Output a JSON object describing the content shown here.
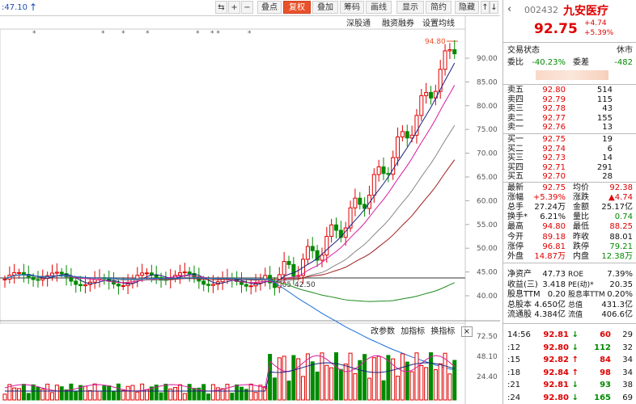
{
  "top_left_text": ":47.10",
  "toolbar": {
    "buttons": [
      "⇆",
      "+",
      "−",
      "叠点",
      "复权",
      "叠加",
      "筹码",
      "画线",
      "显示",
      "简约",
      "隐藏"
    ],
    "active": "复权",
    "scroll_up": "↑",
    "scroll_down": "↓"
  },
  "subbar": {
    "a": "深股通",
    "b": "融资融券",
    "c": "设置均线"
  },
  "star_markers": [
    "*",
    "*",
    "*",
    "*",
    "*",
    "* *",
    "*"
  ],
  "main_chart": {
    "high_label": "94.80",
    "low_label": "42.50",
    "low_date_label": "2.05",
    "price_axis": [
      "90.00",
      "85.00",
      "80.00",
      "75.00",
      "70.00",
      "65.00",
      "60.00",
      "55.00",
      "50.00",
      "45.00",
      "40.00"
    ]
  },
  "vol_chart": {
    "buttons": [
      "改参数",
      "加指标",
      "换指标"
    ],
    "close": "×",
    "axis": [
      "72.50",
      "48.10",
      "24.40"
    ]
  },
  "stock": {
    "code": "002432",
    "name": "九安医疗",
    "price": "92.75",
    "change": "+4.74",
    "pct": "+5.39%"
  },
  "status": {
    "label": "交易状态",
    "value": "休市"
  },
  "ratio": {
    "wb_label": "委比",
    "wb": "-40.23%",
    "wc_label": "委差",
    "wc": "-482"
  },
  "asks": [
    {
      "label": "卖五",
      "price": "92.80",
      "vol": "514"
    },
    {
      "label": "卖四",
      "price": "92.79",
      "vol": "115"
    },
    {
      "label": "卖三",
      "price": "92.78",
      "vol": "43"
    },
    {
      "label": "卖二",
      "price": "92.77",
      "vol": "155"
    },
    {
      "label": "卖一",
      "price": "92.76",
      "vol": "13"
    }
  ],
  "bids": [
    {
      "label": "买一",
      "price": "92.75",
      "vol": "19"
    },
    {
      "label": "买二",
      "price": "92.74",
      "vol": "6"
    },
    {
      "label": "买三",
      "price": "92.73",
      "vol": "14"
    },
    {
      "label": "买四",
      "price": "92.71",
      "vol": "291"
    },
    {
      "label": "买五",
      "price": "92.70",
      "vol": "28"
    }
  ],
  "stats": [
    {
      "l1": "最新",
      "v1": "92.75",
      "c1": "red",
      "l2": "均价",
      "v2": "92.38",
      "c2": "red"
    },
    {
      "l1": "涨幅",
      "v1": "+5.39%",
      "c1": "red",
      "l2": "涨跌",
      "v2": "▲4.74",
      "c2": "red"
    },
    {
      "l1": "总手",
      "v1": "27.24万",
      "c1": "black",
      "l2": "金额",
      "v2": "25.17亿",
      "c2": "black"
    },
    {
      "l1": "换手*",
      "v1": "6.21%",
      "c1": "black",
      "l2": "量比",
      "v2": "0.74",
      "c2": "green"
    },
    {
      "l1": "最高",
      "v1": "94.80",
      "c1": "red",
      "l2": "最低",
      "v2": "88.25",
      "c2": "red"
    },
    {
      "l1": "今开",
      "v1": "89.18",
      "c1": "red",
      "l2": "昨收",
      "v2": "88.01",
      "c2": "black"
    },
    {
      "l1": "涨停",
      "v1": "96.81",
      "c1": "red",
      "l2": "跌停",
      "v2": "79.21",
      "c2": "green"
    },
    {
      "l1": "外盘",
      "v1": "14.87万",
      "c1": "red",
      "l2": "内盘",
      "v2": "12.38万",
      "c2": "green"
    }
  ],
  "fin": [
    {
      "l1": "净资产",
      "v1": "47.73",
      "l2": "ROE",
      "v2": "7.39%"
    },
    {
      "l1": "收益(三)",
      "v1": "3.418",
      "l2": "PE(动)*",
      "v2": "20.35"
    },
    {
      "l1": "股息TTM",
      "v1": "0.20",
      "l2": "股息率TTM",
      "v2": "0.20%"
    },
    {
      "l1": "总股本",
      "v1": "4.650亿",
      "l2": "总值",
      "v2": "431.3亿"
    },
    {
      "l1": "流通股",
      "v1": "4.384亿",
      "l2": "流值",
      "v2": "406.6亿"
    }
  ],
  "ticks": [
    {
      "time": "14:56",
      "price": "92.81",
      "arrow": "↓",
      "vol": "60",
      "n": "29",
      "pc": "red",
      "ac": "green",
      "vc": "red"
    },
    {
      "time": ":12",
      "price": "92.80",
      "arrow": "↓",
      "vol": "112",
      "n": "32",
      "pc": "red",
      "ac": "green",
      "vc": "green"
    },
    {
      "time": ":15",
      "price": "92.82",
      "arrow": "↑",
      "vol": "84",
      "n": "34",
      "pc": "red",
      "ac": "red",
      "vc": "red"
    },
    {
      "time": ":18",
      "price": "92.84",
      "arrow": "↑",
      "vol": "98",
      "n": "34",
      "pc": "red",
      "ac": "red",
      "vc": "red"
    },
    {
      "time": ":21",
      "price": "92.81",
      "arrow": "↓",
      "vol": "93",
      "n": "38",
      "pc": "red",
      "ac": "green",
      "vc": "green"
    },
    {
      "time": ":24",
      "price": "92.80",
      "arrow": "↓",
      "vol": "165",
      "n": "69",
      "pc": "red",
      "ac": "green",
      "vc": "green"
    }
  ]
}
